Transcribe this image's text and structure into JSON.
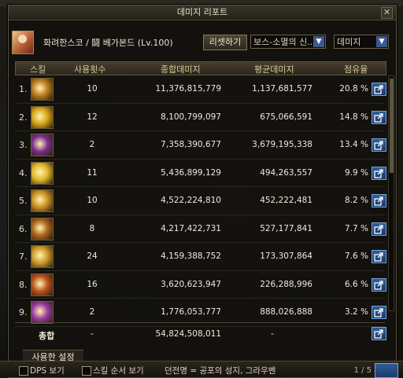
{
  "window": {
    "title": "데미지 리포트",
    "close_label": "✕"
  },
  "header": {
    "character_name": "화려한스코 / 鬪 베가본드 (Lv.100)",
    "reset_button": "리셋하기",
    "boss_select": "보스-소멸의 신...",
    "type_select": "데미지"
  },
  "columns": [
    "스킬",
    "사용횟수",
    "종합데미지",
    "평균데미지",
    "점유율"
  ],
  "rows": [
    {
      "rank": "1.",
      "count": "10",
      "total": "11,376,815,779",
      "avg": "1,137,681,577",
      "share": "20.8 %",
      "icon_color": "#b87a1e"
    },
    {
      "rank": "2.",
      "count": "12",
      "total": "8,100,799,097",
      "avg": "675,066,591",
      "share": "14.8 %",
      "icon_color": "#d6a41a"
    },
    {
      "rank": "3.",
      "count": "2",
      "total": "7,358,390,677",
      "avg": "3,679,195,338",
      "share": "13.4 %",
      "icon_color": "#7b2f8c"
    },
    {
      "rank": "4.",
      "count": "11",
      "total": "5,436,899,129",
      "avg": "494,263,557",
      "share": "9.9 %",
      "icon_color": "#e0b82a"
    },
    {
      "rank": "5.",
      "count": "10",
      "total": "4,522,224,810",
      "avg": "452,222,481",
      "share": "8.2 %",
      "icon_color": "#c98f24"
    },
    {
      "rank": "6.",
      "count": "8",
      "total": "4,217,422,731",
      "avg": "527,177,841",
      "share": "7.7 %",
      "icon_color": "#a8621c"
    },
    {
      "rank": "7.",
      "count": "24",
      "total": "4,159,388,752",
      "avg": "173,307,864",
      "share": "7.6 %",
      "icon_color": "#cc9a2a"
    },
    {
      "rank": "8.",
      "count": "16",
      "total": "3,620,623,947",
      "avg": "226,288,996",
      "share": "6.6 %",
      "icon_color": "#b8501c"
    },
    {
      "rank": "9.",
      "count": "2",
      "total": "1,776,053,777",
      "avg": "888,026,888",
      "share": "3.2 %",
      "icon_color": "#9a3aa0"
    }
  ],
  "total": {
    "label": "총합",
    "count": "-",
    "total": "54,824,508,011",
    "avg": "-"
  },
  "footer": {
    "tab": "사용한 설정",
    "dps_view": "DPS 보기",
    "skill_order_view": "스킬 순서 보기",
    "dungeon": "던전명 = 공포의 성지, 그라우벤",
    "page": "1 / 5"
  }
}
